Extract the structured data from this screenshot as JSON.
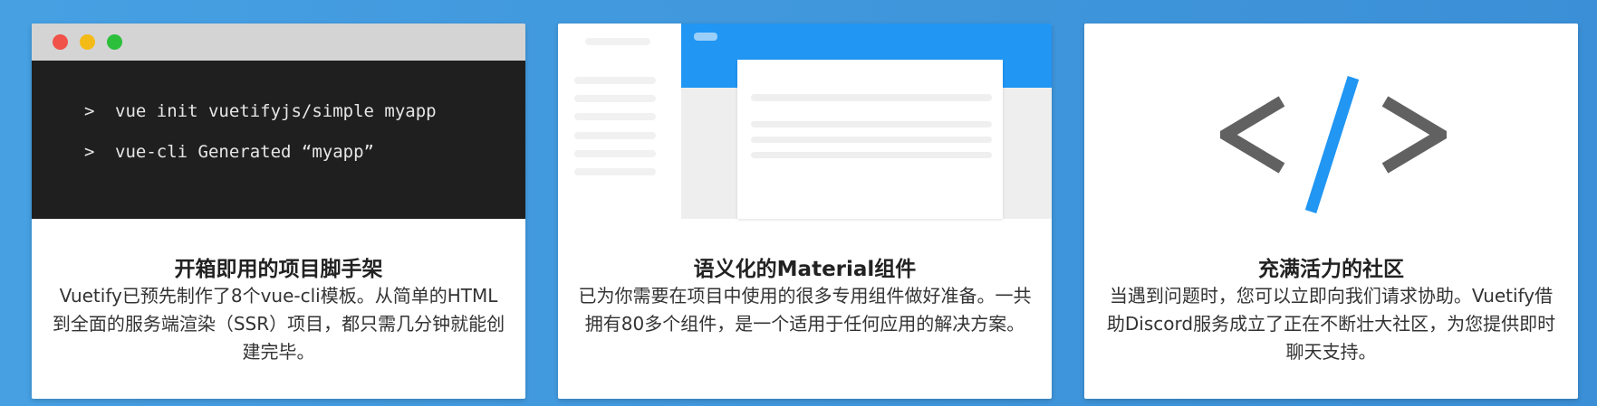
{
  "colors": {
    "background": "#3f95da",
    "card": "#ffffff",
    "terminal_bg": "#1f1f1f",
    "accent_blue": "#2196f3",
    "icon_gray": "#616161"
  },
  "cards": [
    {
      "terminal": {
        "lines": [
          {
            "prompt": ">",
            "text": "vue init vuetifyjs/simple myapp"
          },
          {
            "prompt": ">",
            "text": "vue-cli Generated “myapp”"
          }
        ]
      },
      "title": "开箱即用的项目脚手架",
      "description": "Vuetify已预先制作了8个vue-cli模板。从简单的HTML到全面的服务端渲染（SSR）项目，都只需几分钟就能创建完毕。"
    },
    {
      "illustration": "material-layout-illustration",
      "title": "语义化的Material组件",
      "description": "已为你需要在项目中使用的很多专用组件做好准备。一共拥有80多个组件，是一个适用于任何应用的解决方案。"
    },
    {
      "icon": "code-icon",
      "title": "充满活力的社区",
      "description": "当遇到问题时，您可以立即向我们请求协助。Vuetify借助Discord服务成立了正在不断壮大社区，为您提供即时聊天支持。"
    }
  ]
}
